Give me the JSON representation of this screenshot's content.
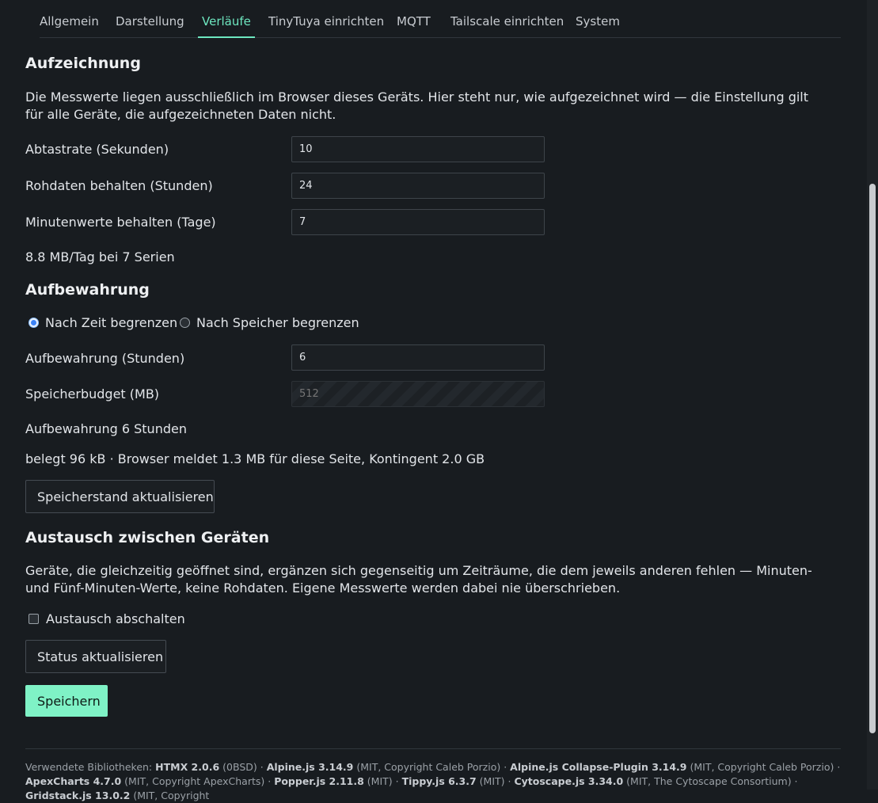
{
  "tabs": [
    {
      "label": "Allgemein",
      "active": false
    },
    {
      "label": "Darstellung",
      "active": false
    },
    {
      "label": "Verläufe",
      "active": true
    },
    {
      "label": "TinyTuya einrichten",
      "active": false
    },
    {
      "label": "MQTT",
      "active": false
    },
    {
      "label": "Tailscale einrichten",
      "active": false
    },
    {
      "label": "System",
      "active": false
    }
  ],
  "recording": {
    "title": "Aufzeichnung",
    "description": "Die Messwerte liegen ausschließlich im Browser dieses Geräts. Hier steht nur, wie aufgezeichnet wird — die Einstellung gilt für alle Geräte, die aufgezeichneten Daten nicht.",
    "sample_rate_label": "Abtastrate (Sekunden)",
    "sample_rate_value": "10",
    "raw_keep_label": "Rohdaten behalten (Stunden)",
    "raw_keep_value": "24",
    "minute_keep_label": "Minutenwerte behalten (Tage)",
    "minute_keep_value": "7",
    "summary": "8.8 MB/Tag bei 7 Serien"
  },
  "retention": {
    "title": "Aufbewahrung",
    "radio_time_label": "Nach Zeit begrenzen",
    "radio_storage_label": "Nach Speicher begrenzen",
    "selected": "time",
    "hours_label": "Aufbewahrung (Stunden)",
    "hours_value": "6",
    "budget_label": "Speicherbudget (MB)",
    "budget_placeholder": "512",
    "summary": "Aufbewahrung 6 Stunden",
    "usage": "belegt 96 kB · Browser meldet 1.3 MB für diese Seite, Kontingent 2.0 GB",
    "refresh_button": "Speicherstand aktualisieren"
  },
  "exchange": {
    "title": "Austausch zwischen Geräten",
    "description": "Geräte, die gleichzeitig geöffnet sind, ergänzen sich gegenseitig um Zeiträume, die dem jeweils anderen fehlen — Minuten- und Fünf-Minuten-Werte, keine Rohdaten. Eigene Messwerte werden dabei nie überschrieben.",
    "disable_label": "Austausch abschalten",
    "disable_checked": false,
    "status_button": "Status aktualisieren"
  },
  "save_button": "Speichern",
  "footer": {
    "prefix": "Verwendete Bibliotheken:",
    "libs": [
      {
        "name": "HTMX 2.0.6",
        "license": "(0BSD)"
      },
      {
        "name": "Alpine.js 3.14.9",
        "license": "(MIT, Copyright Caleb Porzio)"
      },
      {
        "name": "Alpine.js Collapse-Plugin 3.14.9",
        "license": "(MIT, Copyright Caleb Porzio)"
      },
      {
        "name": "ApexCharts 4.7.0",
        "license": "(MIT, Copyright ApexCharts)"
      },
      {
        "name": "Popper.js 2.11.8",
        "license": "(MIT)"
      },
      {
        "name": "Tippy.js 6.3.7",
        "license": "(MIT)"
      },
      {
        "name": "Cytoscape.js 3.34.0",
        "license": "(MIT, The Cytoscape Consortium)"
      },
      {
        "name": "Gridstack.js 13.0.2",
        "license": "(MIT, Copyright"
      }
    ],
    "separator": " · "
  }
}
